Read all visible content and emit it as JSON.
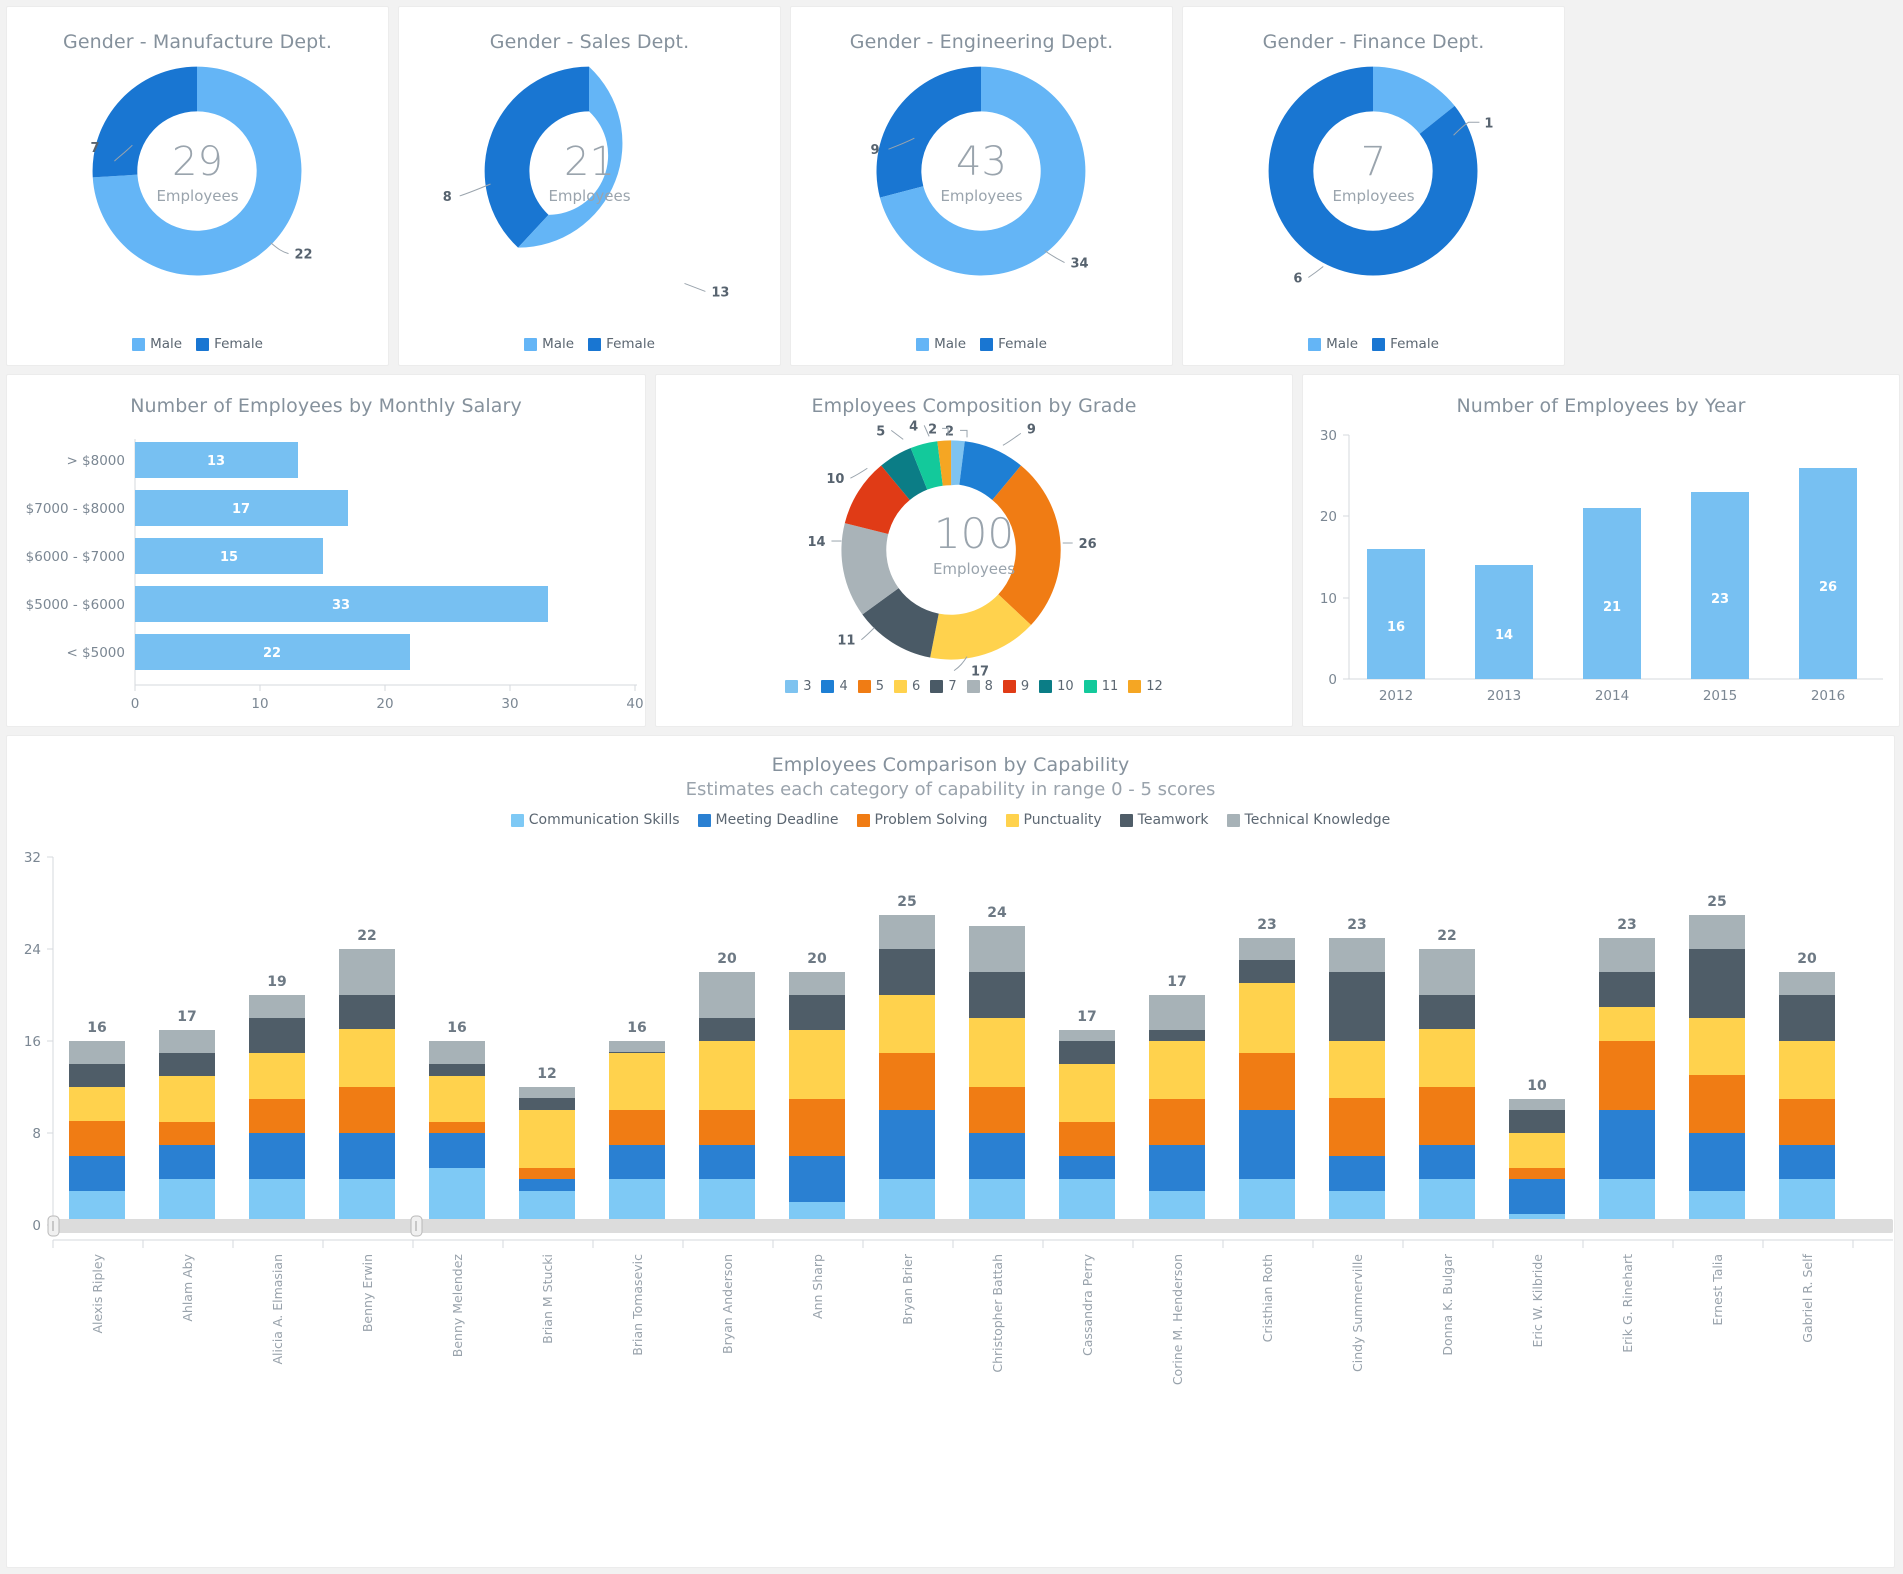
{
  "colors": {
    "male": "#64b5f6",
    "female": "#1976d2",
    "bar_blue": "#77c0f2",
    "grade": [
      "#7ec3f0",
      "#1e7fd4",
      "#f07c14",
      "#ffd24d",
      "#4a5a66",
      "#a9b3b8",
      "#e03b16",
      "#0b7d86",
      "#13c99b",
      "#f5a623"
    ],
    "capability": [
      "#7ec9f5",
      "#2a80d2",
      "#f07c14",
      "#ffd24d",
      "#4f5d68",
      "#a7b2b7"
    ]
  },
  "donuts": [
    {
      "title": "Gender - Manufacture Dept.",
      "total": "29",
      "total_label": "Employees",
      "legend": [
        {
          "label": "Male"
        },
        {
          "label": "Female"
        }
      ],
      "segments": [
        {
          "name": "Male",
          "value": 22
        },
        {
          "name": "Female",
          "value": 7
        }
      ],
      "callouts": [
        {
          "text": "7"
        },
        {
          "text": "22"
        }
      ]
    },
    {
      "title": "Gender - Sales Dept.",
      "total": "21",
      "total_label": "Employees",
      "legend": [
        {
          "label": "Male"
        },
        {
          "label": "Female"
        }
      ],
      "segments": [
        {
          "name": "Male",
          "value": 13
        },
        {
          "name": "Female",
          "value": 8
        }
      ],
      "callouts": [
        {
          "text": "8"
        },
        {
          "text": "13"
        }
      ]
    },
    {
      "title": "Gender - Engineering Dept.",
      "total": "43",
      "total_label": "Employees",
      "legend": [
        {
          "label": "Male"
        },
        {
          "label": "Female"
        }
      ],
      "segments": [
        {
          "name": "Male",
          "value": 34
        },
        {
          "name": "Female",
          "value": 9
        }
      ],
      "callouts": [
        {
          "text": "9"
        },
        {
          "text": "34"
        }
      ]
    },
    {
      "title": "Gender - Finance Dept.",
      "total": "7",
      "total_label": "Employees",
      "legend": [
        {
          "label": "Male"
        },
        {
          "label": "Female"
        }
      ],
      "segments": [
        {
          "name": "Male",
          "value": 1
        },
        {
          "name": "Female",
          "value": 6
        }
      ],
      "callouts": [
        {
          "text": "1"
        },
        {
          "text": "6"
        }
      ]
    }
  ],
  "salary_chart": {
    "title": "Number of Employees by Monthly Salary"
  },
  "grade_chart": {
    "title": "Employees Composition by Grade",
    "total": "100",
    "total_label": "Employees"
  },
  "year_chart": {
    "title": "Number of Employees by Year"
  },
  "capability_chart": {
    "title": "Employees Comparison by Capability",
    "subtitle": "Estimates each category of capability in range 0 - 5 scores"
  },
  "chart_data": [
    {
      "type": "pie",
      "title": "Gender - Manufacture Dept.",
      "labels": [
        "Male",
        "Female"
      ],
      "values": [
        22,
        7
      ],
      "center_text": "29 Employees",
      "legend_position": "bottom"
    },
    {
      "type": "pie",
      "title": "Gender - Sales Dept.",
      "labels": [
        "Male",
        "Female"
      ],
      "values": [
        13,
        8
      ],
      "center_text": "21 Employees",
      "legend_position": "bottom"
    },
    {
      "type": "pie",
      "title": "Gender - Engineering Dept.",
      "labels": [
        "Male",
        "Female"
      ],
      "values": [
        34,
        9
      ],
      "center_text": "43 Employees",
      "legend_position": "bottom"
    },
    {
      "type": "pie",
      "title": "Gender - Finance Dept.",
      "labels": [
        "Male",
        "Female"
      ],
      "values": [
        1,
        6
      ],
      "center_text": "7 Employees",
      "legend_position": "bottom"
    },
    {
      "type": "bar",
      "orientation": "horizontal",
      "title": "Number of Employees by Monthly Salary",
      "categories": [
        "> $8000",
        "$7000 - $8000",
        "$6000 - $7000",
        "$5000 - $6000",
        "< $5000"
      ],
      "values": [
        13,
        17,
        15,
        33,
        22
      ],
      "xlabel": "",
      "ylabel": "",
      "xlim": [
        0,
        40
      ],
      "xticks": [
        0,
        10,
        20,
        30,
        40
      ],
      "grid": false
    },
    {
      "type": "pie",
      "title": "Employees Composition by Grade",
      "labels": [
        "3",
        "4",
        "5",
        "6",
        "7",
        "8",
        "9",
        "10",
        "11",
        "12"
      ],
      "values": [
        2,
        9,
        26,
        17,
        11,
        14,
        10,
        5,
        4,
        2
      ],
      "center_text": "100 Employees",
      "legend_position": "bottom"
    },
    {
      "type": "bar",
      "orientation": "vertical",
      "title": "Number of Employees by Year",
      "categories": [
        "2012",
        "2013",
        "2014",
        "2015",
        "2016"
      ],
      "values": [
        16,
        14,
        21,
        23,
        26
      ],
      "xlabel": "",
      "ylabel": "",
      "ylim": [
        0,
        30
      ],
      "yticks": [
        0,
        10,
        20,
        30
      ],
      "grid": false
    },
    {
      "type": "bar",
      "stacked": true,
      "orientation": "vertical",
      "title": "Employees Comparison by Capability",
      "subtitle": "Estimates each category of capability in range 0 - 5 scores",
      "categories": [
        "Alexis Ripley",
        "Ahlam Aby",
        "Alicia A. Elmasian",
        "Benny Erwin",
        "Benny Melendez",
        "Brian M Stucki",
        "Brian Tomasevic",
        "Bryan Anderson",
        "Ann Sharp",
        "Bryan Brier",
        "Christopher Battah",
        "Cassandra Perry",
        "Corine M. Henderson",
        "Cristhian Roth",
        "Cindy Summerville",
        "Donna K. Bulgar",
        "Eric W. Kilbride",
        "Erik G. Rinehart",
        "Ernest Talia",
        "Gabriel R. Self"
      ],
      "series": [
        {
          "name": "Communication Skills",
          "values": [
            3,
            4,
            4,
            4,
            5,
            3,
            3,
            4,
            2,
            3,
            3,
            3,
            2,
            3,
            3,
            3,
            1,
            3,
            3,
            3
          ]
        },
        {
          "name": "Meeting Deadline",
          "values": [
            3,
            3,
            4,
            4,
            2,
            1,
            3,
            3,
            4,
            6,
            3,
            2,
            3,
            6,
            3,
            3,
            2,
            5,
            5,
            3
          ]
        },
        {
          "name": "Problem Solving",
          "values": [
            3,
            2,
            3,
            3,
            1,
            1,
            3,
            2,
            2,
            4,
            3,
            2,
            3,
            3,
            4,
            4,
            1,
            5,
            3,
            3
          ]
        },
        {
          "name": "Punctuality",
          "values": [
            3,
            4,
            4,
            4,
            4,
            5,
            5,
            5,
            5,
            5,
            4,
            4,
            4,
            4,
            5,
            4,
            3,
            2,
            4,
            4
          ]
        },
        {
          "name": "Teamwork",
          "values": [
            2,
            2,
            3,
            3,
            2,
            1,
            1,
            2,
            4,
            4,
            4,
            3,
            1,
            2,
            5,
            3,
            2,
            3,
            5,
            3
          ]
        },
        {
          "name": "Technical Knowledge",
          "values": [
            2,
            2,
            3,
            4,
            2,
            1,
            1,
            4,
            3,
            3,
            7,
            3,
            4,
            5,
            3,
            5,
            1,
            5,
            5,
            4
          ]
        }
      ],
      "totals": [
        16,
        17,
        19,
        22,
        16,
        12,
        16,
        20,
        20,
        25,
        24,
        17,
        17,
        23,
        23,
        22,
        10,
        23,
        25,
        20
      ],
      "ylim": [
        0,
        32
      ],
      "yticks": [
        0,
        8,
        16,
        24,
        32
      ],
      "grid": false,
      "legend_position": "top"
    }
  ]
}
